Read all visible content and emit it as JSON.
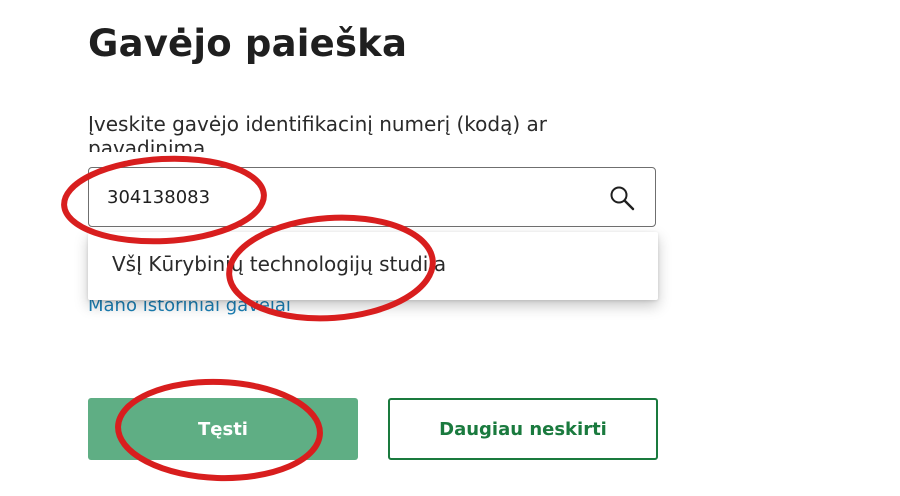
{
  "page": {
    "title": "Gavėjo paieška"
  },
  "search": {
    "label": "Įveskite gavėjo identifikacinį numerį (kodą) ar pavadinimą",
    "value": "304138083",
    "icon": "search-icon"
  },
  "suggestions": [
    {
      "label": "VšĮ Kūrybinių technologijų studija"
    }
  ],
  "history_link": "Mano istoriniai gavėjai",
  "buttons": {
    "continue_label": "Tęsti",
    "more_label": "Daugiau neskirti"
  },
  "colors": {
    "primary_button": "#5fae84",
    "secondary_button_border": "#1a7a3e",
    "link": "#1a7fb5",
    "annotation": "#d81e1e"
  }
}
